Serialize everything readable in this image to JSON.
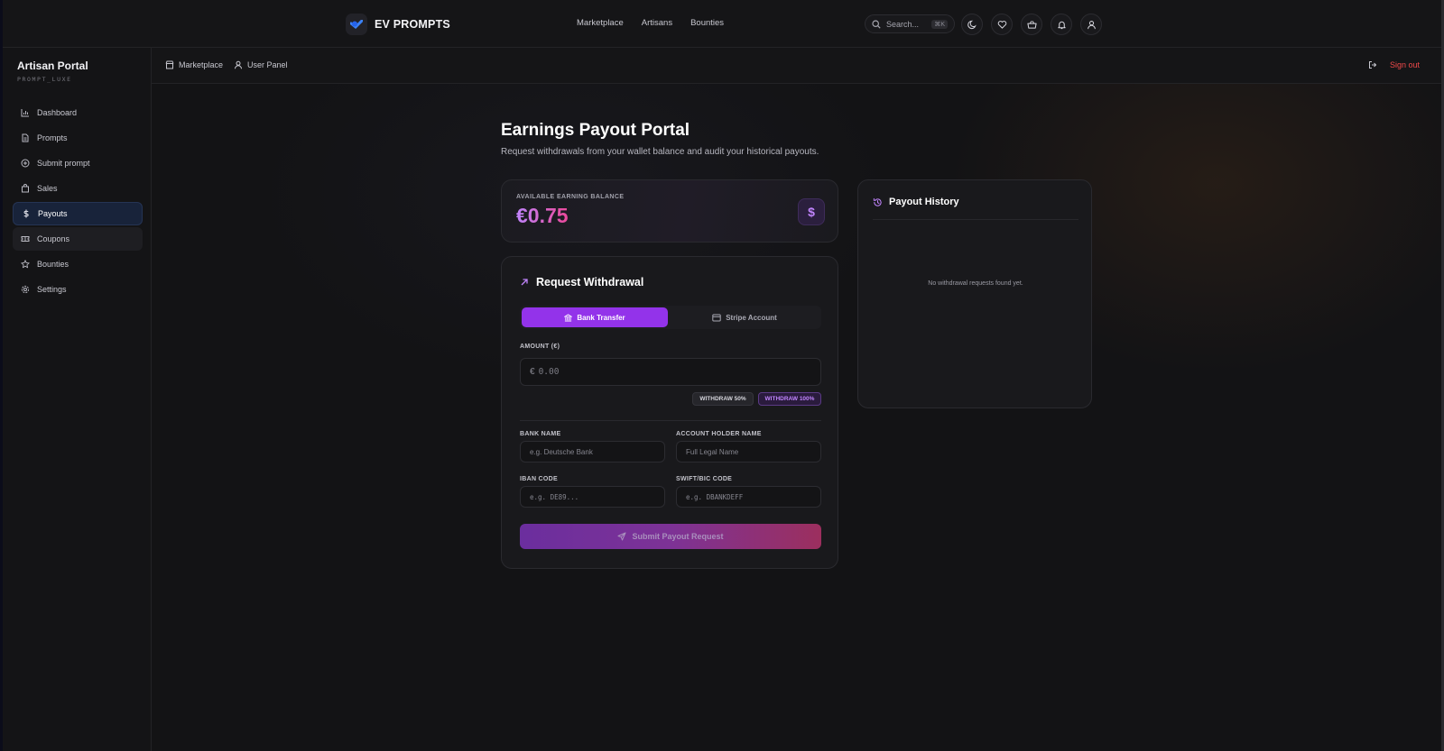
{
  "topnav": {
    "brand": "EV PROMPTS",
    "links": [
      "Marketplace",
      "Artisans",
      "Bounties"
    ],
    "search_label": "Search...",
    "search_shortcut": "⌘K"
  },
  "sidebar": {
    "title": "Artisan Portal",
    "subtitle": "PROMPT_LUXE",
    "items": [
      {
        "label": "Dashboard",
        "icon": "bar-chart-icon"
      },
      {
        "label": "Prompts",
        "icon": "file-icon"
      },
      {
        "label": "Submit prompt",
        "icon": "plus-circle-icon"
      },
      {
        "label": "Sales",
        "icon": "bag-icon"
      },
      {
        "label": "Payouts",
        "icon": "dollar-icon"
      },
      {
        "label": "Coupons",
        "icon": "ticket-icon"
      },
      {
        "label": "Bounties",
        "icon": "star-icon"
      },
      {
        "label": "Settings",
        "icon": "gear-icon"
      }
    ],
    "active": "Payouts"
  },
  "header": {
    "crumbs": [
      "Marketplace",
      "User Panel"
    ],
    "signout": "Sign out"
  },
  "page": {
    "title": "Earnings Payout Portal",
    "subtitle": "Request withdrawals from your wallet balance and audit your historical payouts."
  },
  "balance": {
    "label": "AVAILABLE EARNING BALANCE",
    "value": "€0.75"
  },
  "withdrawal": {
    "title": "Request Withdrawal",
    "tabs": [
      "Bank Transfer",
      "Stripe Account"
    ],
    "active_tab": "Bank Transfer",
    "amount_label": "AMOUNT (€)",
    "amount_prefix": "€",
    "amount_placeholder": "0.00",
    "withdraw_50": "WITHDRAW 50%",
    "withdraw_100": "WITHDRAW 100%",
    "bank_name_label": "BANK NAME",
    "bank_name_placeholder": "e.g. Deutsche Bank",
    "holder_label": "ACCOUNT HOLDER NAME",
    "holder_placeholder": "Full Legal Name",
    "iban_label": "IBAN CODE",
    "iban_placeholder": "e.g. DE89...",
    "swift_label": "SWIFT/BIC CODE",
    "swift_placeholder": "e.g. DBANKDEFF",
    "submit": "Submit Payout Request"
  },
  "history": {
    "title": "Payout History",
    "empty": "No withdrawal requests found yet."
  },
  "colors": {
    "accent": "#9333ea",
    "active_nav": "#18233a",
    "signout": "#ef4a4a",
    "balance_gradient": [
      "#c084fc",
      "#ec4899"
    ]
  }
}
